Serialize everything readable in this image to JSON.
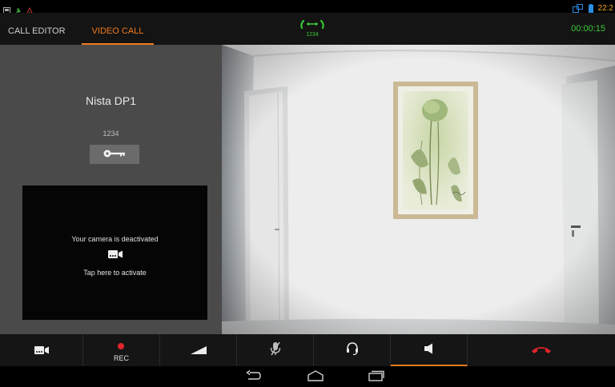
{
  "status_bar": {
    "time": "22:2",
    "icons": [
      "screenshot-icon",
      "call-active-icon",
      "alert-icon",
      "network-icon",
      "battery-icon"
    ]
  },
  "header": {
    "tabs": [
      {
        "label": "CALL EDITOR",
        "active": false
      },
      {
        "label": "VIDEO CALL",
        "active": true
      }
    ],
    "call_number": "1234",
    "call_timer": "00:00:15",
    "call_status_icon": "call-in-progress-icon"
  },
  "contact": {
    "name": "Nista DP1",
    "number": "1234",
    "key_button_icon": "key-icon"
  },
  "camera_panel": {
    "deactivated_text": "Your camera is deactivated",
    "activate_text": "Tap here to activate",
    "icon": "video-camera-icon"
  },
  "toolbar": {
    "buttons": [
      {
        "name": "video-toggle",
        "icon": "video-camera-icon"
      },
      {
        "name": "record",
        "icon": "record-dot-icon",
        "label": "REC"
      },
      {
        "name": "volume",
        "icon": "volume-wedge-icon"
      },
      {
        "name": "mute-mic",
        "icon": "mic-off-icon"
      },
      {
        "name": "headset",
        "icon": "headset-icon"
      },
      {
        "name": "speaker",
        "icon": "speaker-icon",
        "active": true
      },
      {
        "name": "hang-up",
        "icon": "end-call-icon"
      }
    ]
  },
  "nav_bar": {
    "icons": [
      "back-icon",
      "home-icon",
      "recent-apps-icon"
    ]
  },
  "colors": {
    "accent": "#f07a1e",
    "call_green": "#39c936",
    "end_call_red": "#e0242b",
    "status_orange": "#f5a623"
  }
}
